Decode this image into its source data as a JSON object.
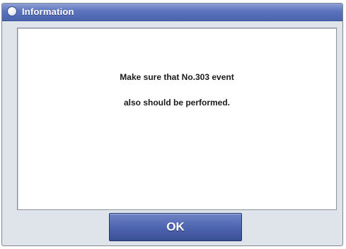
{
  "window": {
    "title": "Information",
    "icon": "info-dot-icon"
  },
  "message": {
    "line1": "Make sure that No.303 event",
    "line2": "also should be performed."
  },
  "buttons": {
    "ok_label": "OK"
  },
  "colors": {
    "titlebar": "#5c74bd",
    "button": "#4e66b0",
    "panel_bg": "#ffffff",
    "dialog_bg": "#dfe3ea"
  }
}
